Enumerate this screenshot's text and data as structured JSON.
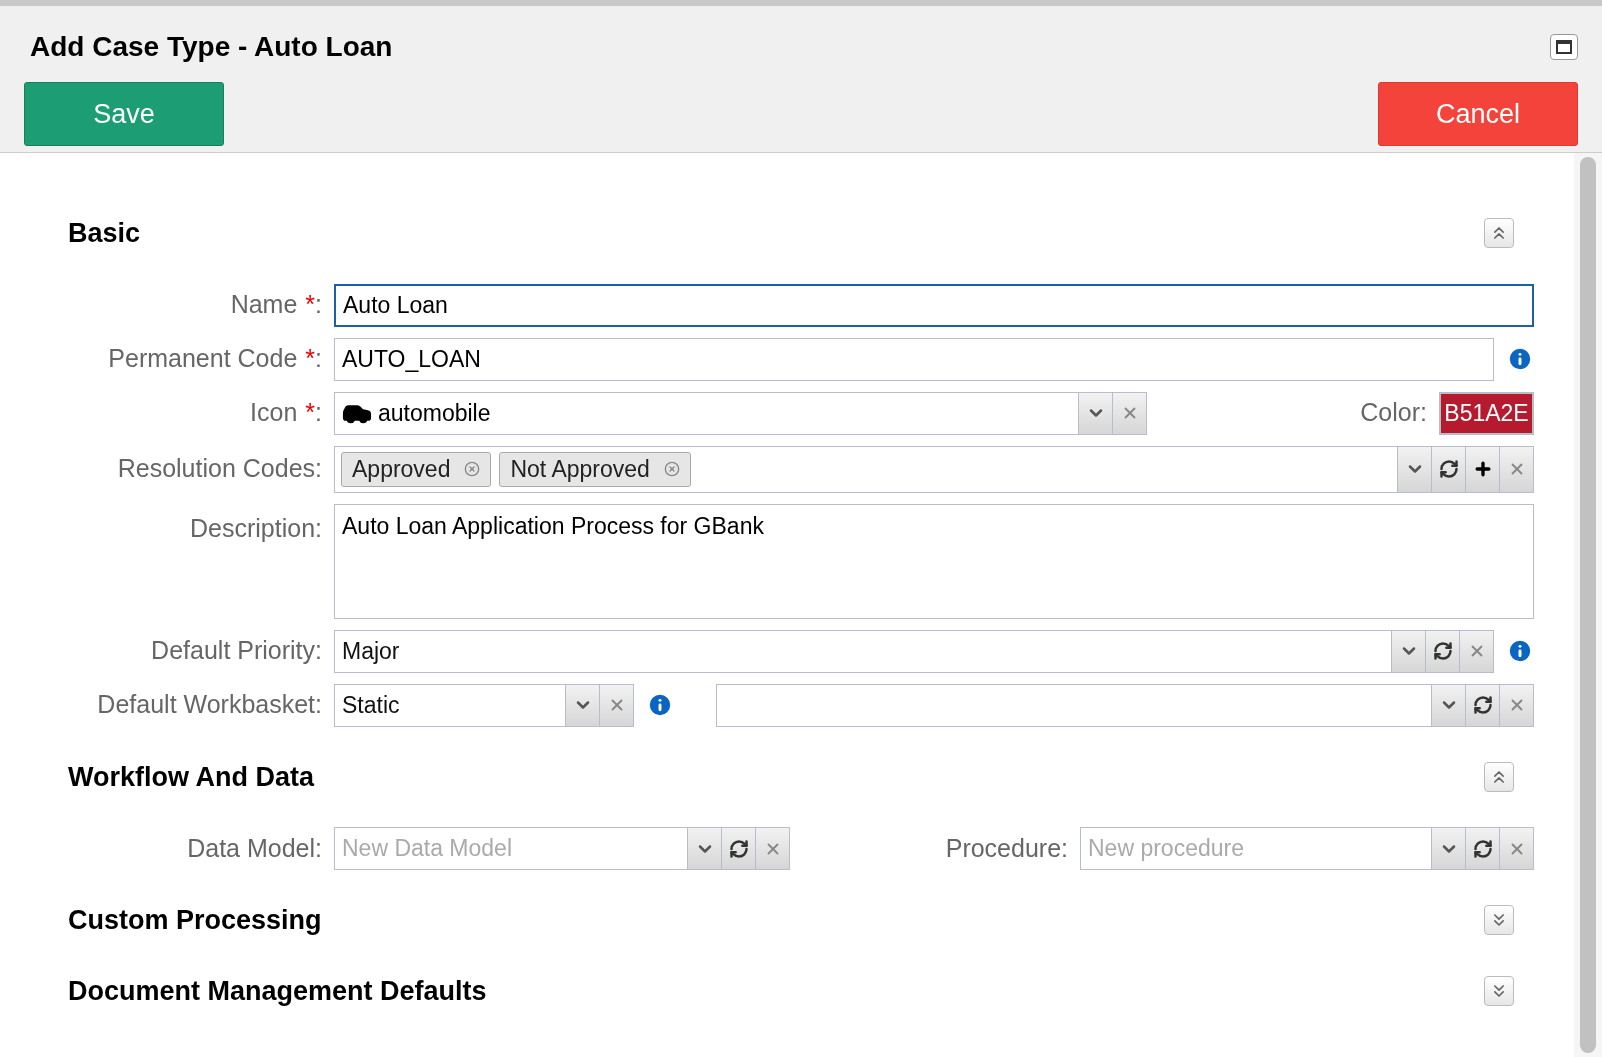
{
  "window": {
    "title": "Add Case Type - Auto Loan"
  },
  "buttons": [
    {
      "kind": "save",
      "label": "Save"
    },
    {
      "kind": "cancel",
      "label": "Cancel"
    }
  ],
  "sections": [
    {
      "kind": "basic",
      "title": "Basic",
      "expanded": true,
      "fields": [
        {
          "kind": "text",
          "label": "Name",
          "mark": "*",
          "colon": ":",
          "value": "Auto Loan",
          "focused": true,
          "info": false
        },
        {
          "kind": "text",
          "label": "Permanent Code",
          "mark": "*",
          "colon": ":",
          "value": "AUTO_LOAN",
          "focused": false,
          "info": true
        },
        {
          "kind": "icon_select",
          "label": "Icon",
          "mark": "*",
          "colon": ":",
          "value": "automobile",
          "controls": [
            {
              "kind": "dropdown"
            },
            {
              "kind": "clear"
            }
          ],
          "color_label": "Color:",
          "color_value": "B51A2E",
          "color": "#b51a2e"
        },
        {
          "kind": "tags",
          "label": "Resolution Codes:",
          "tags": [
            "Approved",
            "Not Approved"
          ],
          "controls": [
            {
              "kind": "dropdown"
            },
            {
              "kind": "refresh"
            },
            {
              "kind": "add"
            },
            {
              "kind": "clear"
            }
          ]
        },
        {
          "kind": "textarea",
          "label": "Description:",
          "value": "Auto Loan Application Process for GBank"
        },
        {
          "kind": "select",
          "label": "Default Priority:",
          "value": "Major",
          "controls": [
            {
              "kind": "dropdown"
            },
            {
              "kind": "refresh"
            },
            {
              "kind": "clear"
            }
          ],
          "info": true
        },
        {
          "kind": "workbasket",
          "label": "Default Workbasket:",
          "value": "Static",
          "controls": [
            {
              "kind": "dropdown"
            },
            {
              "kind": "clear"
            }
          ],
          "info": true,
          "second_controls": [
            {
              "kind": "dropdown"
            },
            {
              "kind": "refresh"
            },
            {
              "kind": "clear"
            }
          ]
        }
      ]
    },
    {
      "kind": "workflow",
      "title": "Workflow And Data",
      "expanded": true,
      "fields": [
        {
          "label": "Data Model:",
          "placeholder": "New Data Model",
          "controls": [
            {
              "kind": "dropdown"
            },
            {
              "kind": "refresh"
            },
            {
              "kind": "clear"
            }
          ]
        },
        {
          "label": "Procedure:",
          "placeholder": "New procedure",
          "controls": [
            {
              "kind": "dropdown"
            },
            {
              "kind": "refresh"
            },
            {
              "kind": "clear"
            }
          ]
        }
      ]
    },
    {
      "kind": "plain",
      "title": "Custom Processing",
      "expanded": false
    },
    {
      "kind": "plain",
      "title": "Document Management Defaults",
      "expanded": false
    }
  ]
}
